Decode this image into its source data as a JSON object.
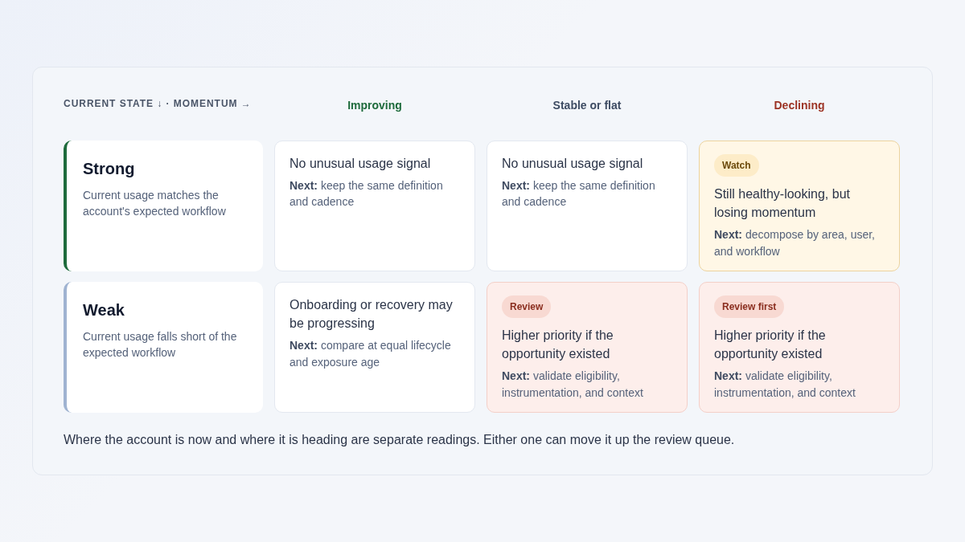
{
  "axis_label": "CURRENT STATE ↓ · MOMENTUM →",
  "columns": [
    {
      "label": "Improving",
      "color": "#1e6b3c"
    },
    {
      "label": "Stable or flat",
      "color": "#3e4c63"
    },
    {
      "label": "Declining",
      "color": "#9c3324"
    }
  ],
  "rows": [
    {
      "title": "Strong",
      "description": "Current usage matches the account's expected workflow",
      "color": "#1e6b3c",
      "cells": [
        {
          "kind": "plain",
          "text": "No unusual usage signal",
          "next": "**Next:** keep the same definition and cadence"
        },
        {
          "kind": "plain",
          "text": "No unusual usage signal",
          "next": "**Next:** keep the same definition and cadence"
        },
        {
          "kind": "watch",
          "badge": "Watch",
          "text": "Still healthy-looking, but losing momentum",
          "next": "**Next:** decompose by area, user, and workflow"
        }
      ]
    },
    {
      "title": "Weak",
      "description": "Current usage falls short of the expected workflow",
      "color": "#9fb3d1",
      "cells": [
        {
          "kind": "plain",
          "text": "Onboarding or recovery may be progressing",
          "next": "**Next:** compare at equal lifecycle and exposure age"
        },
        {
          "kind": "review",
          "badge": "Review",
          "text": "Higher priority if the opportunity existed",
          "next": "**Next:** validate eligibility, instrumentation, and context"
        },
        {
          "kind": "review",
          "badge": "Review first",
          "text": "Higher priority if the opportunity existed",
          "next": "**Next:** validate eligibility, instrumentation, and context"
        }
      ]
    }
  ],
  "footnote": "Where the account is now and where it is heading are separate readings. Either one can move it up the review queue."
}
